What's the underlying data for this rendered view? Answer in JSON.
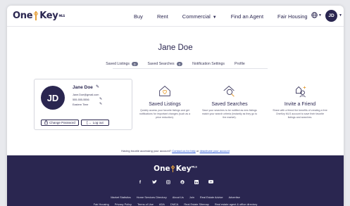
{
  "header": {
    "brand": {
      "prefix": "One",
      "suffix": "Key",
      "mark": "MLS"
    },
    "nav": [
      "Buy",
      "Rent",
      "Commercial",
      "Find an Agent",
      "Fair Housing"
    ],
    "avatar_initials": "JD",
    "icons": [
      "key-logo-icon",
      "chevron-down-icon",
      "globe-icon",
      "avatar"
    ]
  },
  "profile": {
    "name": "Jane Doe",
    "tabs": [
      {
        "label": "Saved Listings",
        "count": "0"
      },
      {
        "label": "Saved Searches",
        "count": "0"
      },
      {
        "label": "Notification Settings"
      },
      {
        "label": "Profile"
      }
    ],
    "active_tab": "Profile"
  },
  "card": {
    "initials": "JD",
    "name": "Jane Doe",
    "email": "Jane.Doe@gmail.com",
    "phone": "555-555-5556",
    "timezone": "Eastern Time",
    "change_password": "Change Password",
    "logout": "Log out"
  },
  "features": [
    {
      "title": "Saved Listings",
      "desc": "Quickly access your favorite listings and get notifications for important changes (such as a price reduction)."
    },
    {
      "title": "Saved Searches",
      "desc": "Save your searches to be notified as new listings match your search criteria (instantly as they go to the market)."
    },
    {
      "title": "Invite a Friend",
      "desc": "Share with a friend the benefits of creating a free OneKey MLS account to save their favorite listings and searches."
    }
  ],
  "trouble": {
    "text": "Having trouble accessing your account?",
    "help_link": "Contact us for help",
    "or": "or",
    "deactivate_link": "deactivate your account"
  },
  "footer": {
    "brand": {
      "prefix": "One",
      "suffix": "Key",
      "mark": "MLS"
    },
    "socials": [
      "f",
      "t",
      "ig",
      "p",
      "in",
      "yt"
    ],
    "links_row1": [
      "Market Statistics",
      "Home Services Directory",
      "About Us",
      "Join",
      "Real Estate Advice",
      "Advertise"
    ],
    "links_row2": [
      "Fair Housing",
      "Privacy Policy",
      "Terms of Use",
      "ADA",
      "DMCA",
      "Real Estate Sitemap",
      "Real estate agent & office directory"
    ]
  },
  "colors": {
    "brand_navy": "#2a2650",
    "accent_gold": "#e6a23c",
    "link_blue": "#2c5ad6"
  }
}
